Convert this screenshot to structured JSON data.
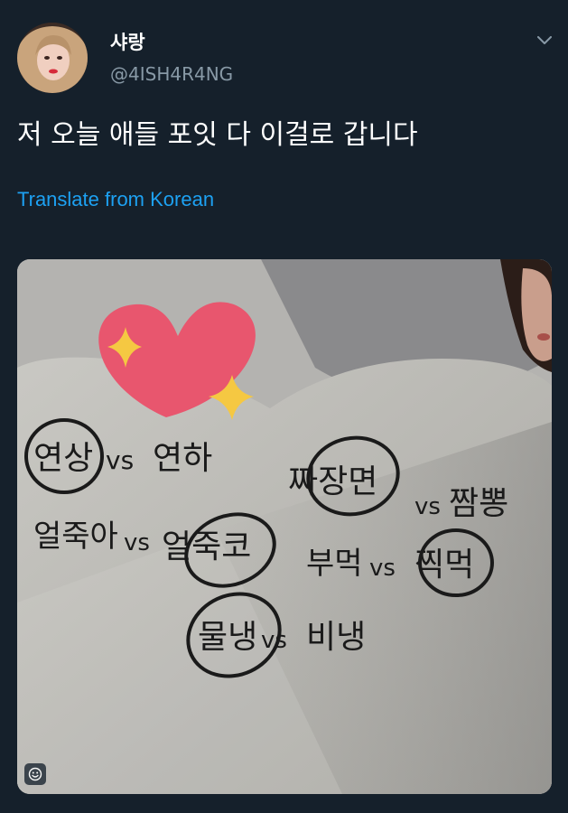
{
  "user": {
    "display_name": "샤랑",
    "handle": "@4ISH4R4NG"
  },
  "tweet": {
    "text": "저 오늘 애들 포잇 다 이걸로 갑니다",
    "translate_label": "Translate from Korean"
  },
  "media": {
    "note_words": [
      "연상",
      "vs",
      "연하",
      "짜장면",
      "vs",
      "짬뽕",
      "얼죽아",
      "vs",
      "얼죽코",
      "부먹",
      "vs",
      "찍먹",
      "물냉",
      "vs",
      "비냉"
    ]
  },
  "icons": {
    "more": "chevron-down-icon",
    "sticker": "smiley-icon"
  },
  "colors": {
    "background": "#15202b",
    "link": "#1da1f2",
    "secondary_text": "#8899a6",
    "heart": "#e8566e",
    "sparkle": "#f5c842"
  }
}
